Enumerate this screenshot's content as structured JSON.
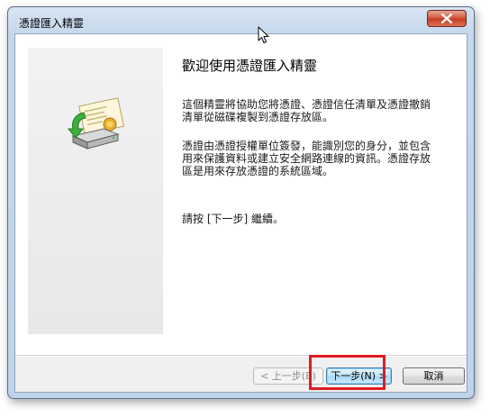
{
  "window": {
    "title": "憑證匯入精靈"
  },
  "content": {
    "heading": "歡迎使用憑證匯入精靈",
    "paragraph1_line1": "這個精靈將協助您將憑證、憑證信任清單及憑證撤銷",
    "paragraph1_line2": "清單從磁碟複製到憑證存放區。",
    "paragraph2_line1": "憑證由憑證授權單位簽發，能識別您的身分，並包含",
    "paragraph2_line2": "用來保護資料或建立安全網路連線的資訊。憑證存放",
    "paragraph2_line3": "區是用來存放憑證的系統區域。",
    "paragraph3": "請按 [下一步] 繼續。"
  },
  "buttons": {
    "back_label": "< 上一步(B)",
    "next_label": "下一步(N) >",
    "cancel_label": "取消"
  },
  "icons": {
    "wizard": "certificate-import-icon",
    "close": "close-icon",
    "cursor": "mouse-pointer-icon"
  },
  "colors": {
    "highlight": "#e01b24",
    "close_button": "#c3391d",
    "default_button_border": "#3c7fb1"
  }
}
